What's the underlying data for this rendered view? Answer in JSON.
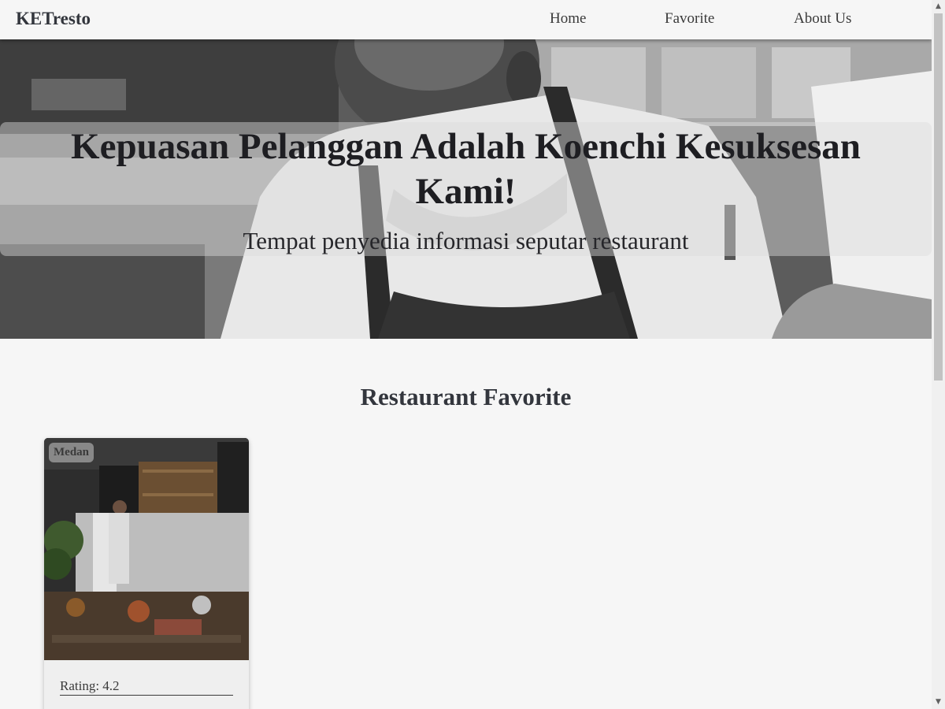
{
  "app_bar": {
    "brand": "KETresto",
    "nav": [
      {
        "label": "Home"
      },
      {
        "label": "Favorite"
      },
      {
        "label": "About Us"
      }
    ]
  },
  "hero": {
    "title": "Kepuasan Pelanggan Adalah Koenchi Kesuksesan Kami!",
    "tagline": "Tempat penyedia informasi seputar restaurant"
  },
  "main": {
    "section_title": "Restaurant Favorite",
    "restaurants": [
      {
        "city": "Medan",
        "rating_text": "Rating: 4.2"
      }
    ]
  },
  "scrollbar": {
    "up_icon": "▲",
    "down_icon": "▼"
  },
  "colors": {
    "background": "#f6f6f6",
    "text": "#33363d",
    "card": "#efefef"
  }
}
